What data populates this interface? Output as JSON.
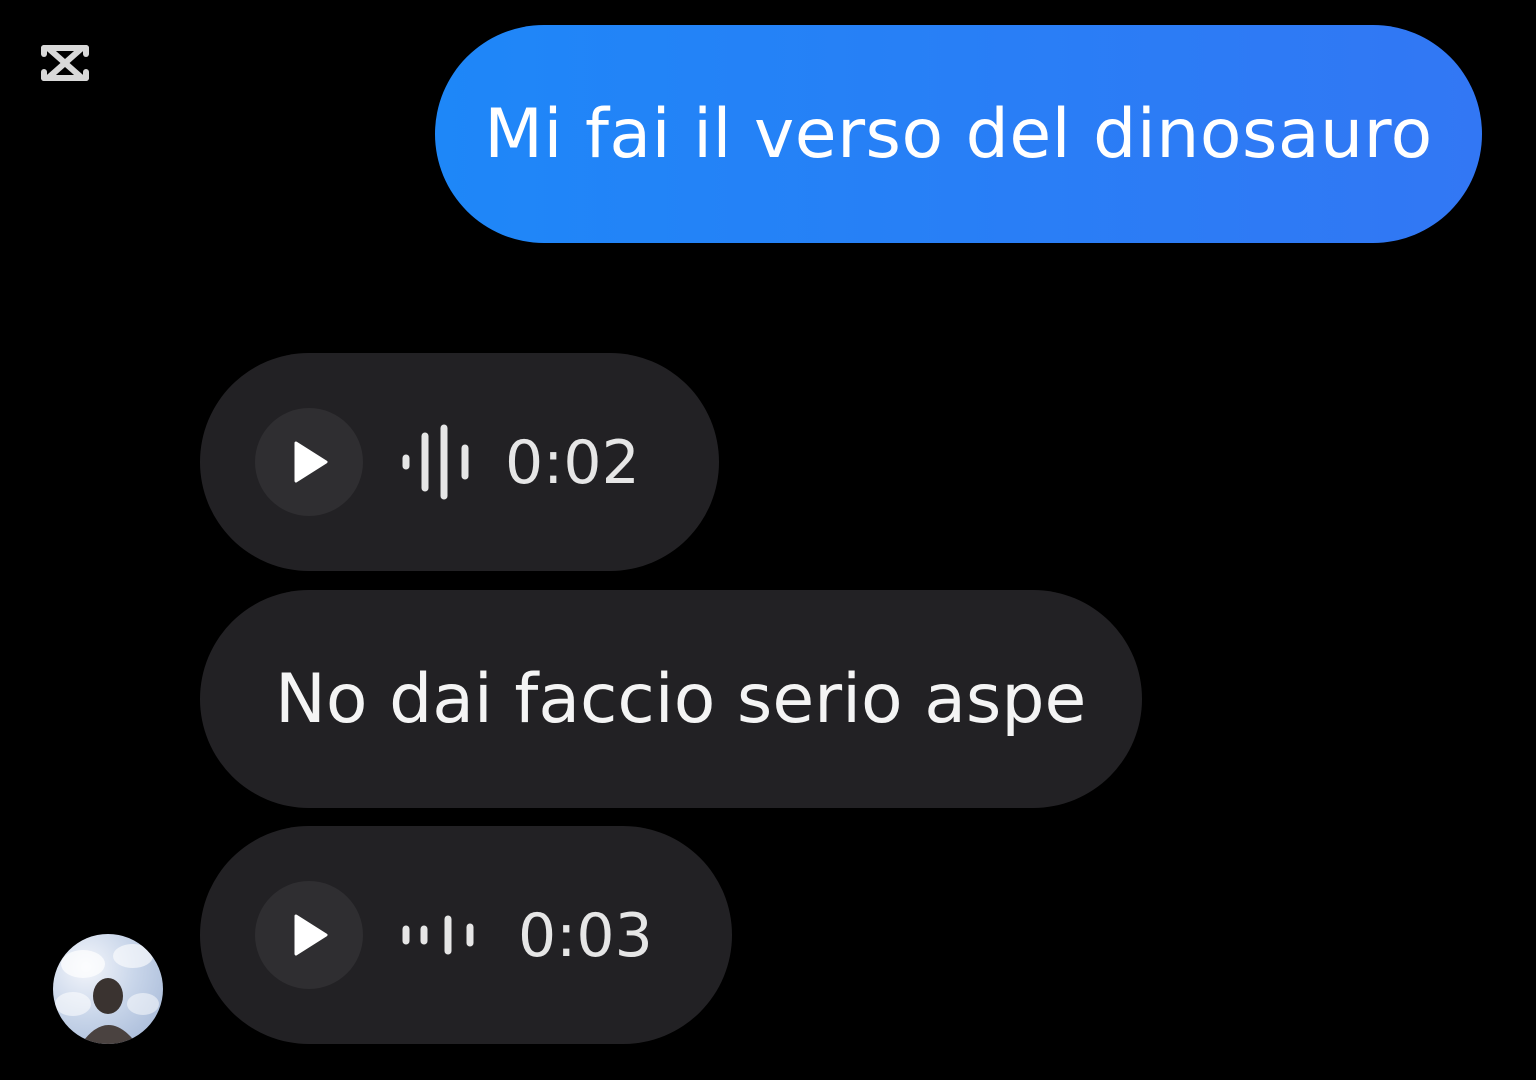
{
  "app": {
    "watermark_icon": "capcut-logo-icon"
  },
  "colors": {
    "background": "#000000",
    "outgoing_bubble_start": "#1e87f8",
    "outgoing_bubble_end": "#3277f4",
    "incoming_bubble": "#222124",
    "play_button_bg": "#2f2e31",
    "text_light": "#f2f2f2"
  },
  "messages": [
    {
      "direction": "outgoing",
      "type": "text",
      "text": "Mi fai il verso del dinosauro"
    },
    {
      "direction": "incoming",
      "type": "voice",
      "icon": "play-icon",
      "waveform_icon": "audio-waveform-icon",
      "duration": "0:02"
    },
    {
      "direction": "incoming",
      "type": "text",
      "text": "No dai faccio serio aspe"
    },
    {
      "direction": "incoming",
      "type": "voice",
      "icon": "play-icon",
      "waveform_icon": "audio-waveform-icon",
      "duration": "0:03"
    }
  ],
  "sender": {
    "avatar_icon": "profile-avatar"
  }
}
